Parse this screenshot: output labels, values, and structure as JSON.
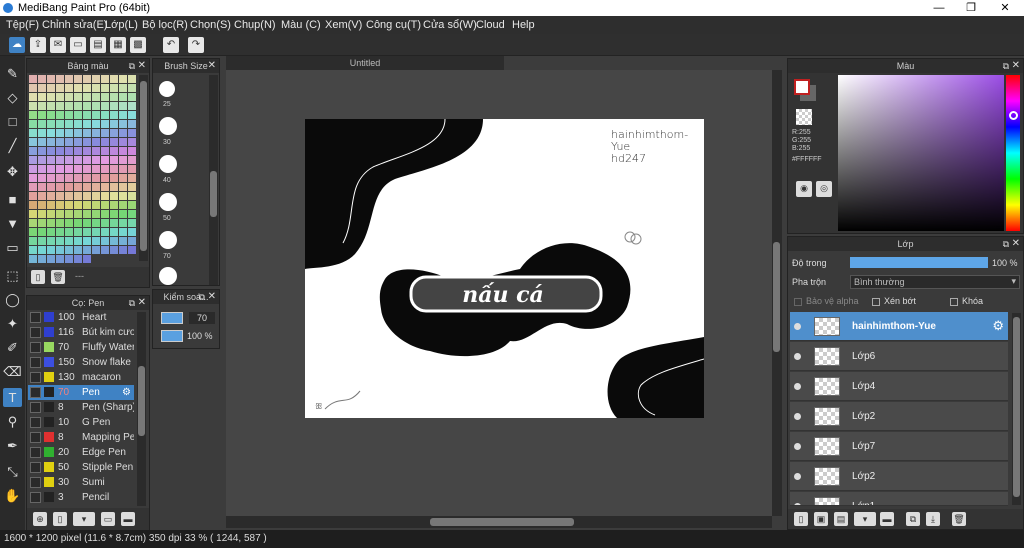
{
  "window": {
    "title": "MediBang Paint Pro (64bit)",
    "minimize": "—",
    "maximize": "❐",
    "close": "✕"
  },
  "menu": [
    "Tệp(F)",
    "Chỉnh sửa(E)",
    "Lớp(L)",
    "Bộ lọc(R)",
    "Chọn(S)",
    "Chụp(N)",
    "Màu (C)",
    "Xem(V)",
    "Công cụ(T)",
    "Cửa sổ(W)",
    "Cloud",
    "Help"
  ],
  "panels": {
    "palette": {
      "title": "Bảng màu"
    },
    "brush_size": {
      "title": "Brush Size",
      "sizes": [
        "25",
        "30",
        "40",
        "50",
        "70"
      ]
    },
    "brush": {
      "title": "Cọ: Pen",
      "items": [
        {
          "num": "100",
          "name": "Heart",
          "color": "#2f3fcf"
        },
        {
          "num": "116",
          "name": "Bút kim cương",
          "color": "#2f3fcf"
        },
        {
          "num": "70",
          "name": "Fluffy Water",
          "color": "#98d860"
        },
        {
          "num": "150",
          "name": "Snow flake 5",
          "color": "#3c4fe0"
        },
        {
          "num": "130",
          "name": "macaron",
          "color": "#e0d010"
        },
        {
          "num": "70",
          "name": "Pen",
          "color": "#222222",
          "selected": true
        },
        {
          "num": "8",
          "name": "Pen (Sharp)",
          "color": "#222222"
        },
        {
          "num": "10",
          "name": "G Pen",
          "color": "#222222"
        },
        {
          "num": "8",
          "name": "Mapping Pen",
          "color": "#e03030"
        },
        {
          "num": "20",
          "name": "Edge Pen",
          "color": "#30b030"
        },
        {
          "num": "50",
          "name": "Stipple Pen",
          "color": "#e0d010"
        },
        {
          "num": "30",
          "name": "Sumi",
          "color": "#e0d010"
        },
        {
          "num": "3",
          "name": "Pencil",
          "color": "#222222"
        }
      ]
    },
    "brush_control": {
      "title": "Kiểm soá...",
      "size_value": "70",
      "opacity_value": "100 %"
    },
    "color": {
      "title": "Màu",
      "r": "R:255",
      "g": "G:255",
      "b": "B:255",
      "hex": "#FFFFFF"
    },
    "layer": {
      "title": "Lớp",
      "opacity_label": "Độ trong",
      "opacity_value": "100 %",
      "opacity": 1.0,
      "blend_label": "Pha trộn",
      "blend_value": "Bình thường",
      "protect_alpha": "Bảo vệ alpha",
      "clipping": "Xén bớt",
      "lock": "Khóa",
      "layers": [
        {
          "name": "hainhimthom-Yue",
          "selected": true
        },
        {
          "name": "Lớp6"
        },
        {
          "name": "Lớp4"
        },
        {
          "name": "Lớp2"
        },
        {
          "name": "Lớp7"
        },
        {
          "name": "Lớp2"
        },
        {
          "name": "Lớp1"
        }
      ]
    }
  },
  "document": {
    "tab_title": "Untitled",
    "watermark_line1": "hainhimthom-Yue",
    "watermark_line2": "hd247",
    "artwork_text": "nấu cá"
  },
  "status": {
    "text": "1600 * 1200 pixel   (11.6 * 8.7cm)   350 dpi   33 %   ( 1244, 587 )"
  },
  "colors": {
    "accent": "#3f82c4",
    "panel": "#3a3a3a",
    "canvas_bg": "#464646"
  }
}
